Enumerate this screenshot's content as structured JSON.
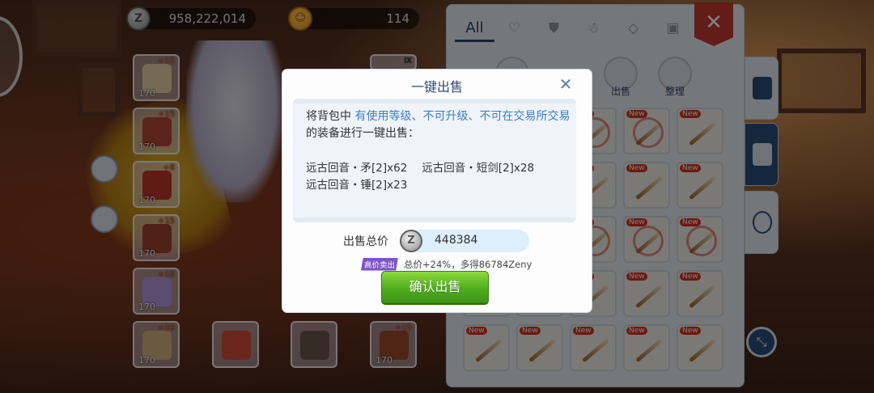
{
  "currency": {
    "zeny_icon": "zeny-coin-icon",
    "zeny_icon_glyph": "Z",
    "zeny_amount": "958,222,014",
    "pink_icon": "event-token-icon",
    "pink_icon_glyph": "☺",
    "pink_amount": "114"
  },
  "equipment_slots": [
    {
      "level": "170",
      "plus": "+15"
    },
    {
      "level": "170",
      "plus": "+15"
    },
    {
      "level": "170",
      "plus": "+8"
    },
    {
      "level": "170",
      "plus": "+15"
    },
    {
      "level": "170",
      "plus": "+10"
    },
    {
      "level": "170",
      "plus": "+10"
    },
    {
      "level": "",
      "plus": ""
    },
    {
      "level": "",
      "plus": ""
    },
    {
      "level": "170",
      "plus": "+15"
    }
  ],
  "slot_corner_label": "IX",
  "inventory": {
    "tabs": [
      {
        "label": "All",
        "icon": "all"
      },
      {
        "label": "",
        "icon": "heart-icon"
      },
      {
        "label": "",
        "icon": "armor-icon"
      },
      {
        "label": "",
        "icon": "costume-icon"
      },
      {
        "label": "",
        "icon": "gem-icon"
      },
      {
        "label": "",
        "icon": "card-icon"
      }
    ],
    "close_glyph": "✕",
    "action_sell": "出售",
    "action_sort": "整理",
    "new_badge": "New"
  },
  "dialog": {
    "title": "一键出售",
    "close_glyph": "✕",
    "desc_prefix": "将背包中 ",
    "desc_highlight": "有使用等级、不可升级、不可在交易所交易",
    "desc_suffix": " 的装备进行一键出售：",
    "items": [
      "远古回音・矛[2]x62",
      "远古回音・短剑[2]x28",
      "远古回音・锤[2]x23"
    ],
    "total_label": "出售总价",
    "total_icon_glyph": "Z",
    "total_value": "448384",
    "bonus_badge": "高价卖出",
    "bonus_text": "总价+24%，多得86784Zeny",
    "confirm_label": "确认出售"
  },
  "colors": {
    "accent_blue": "#3a7ec6",
    "title_blue": "#2f4f73",
    "confirm_green": "#4fad1f",
    "close_red": "#c7392e",
    "badge_purple": "#7c54c6"
  }
}
